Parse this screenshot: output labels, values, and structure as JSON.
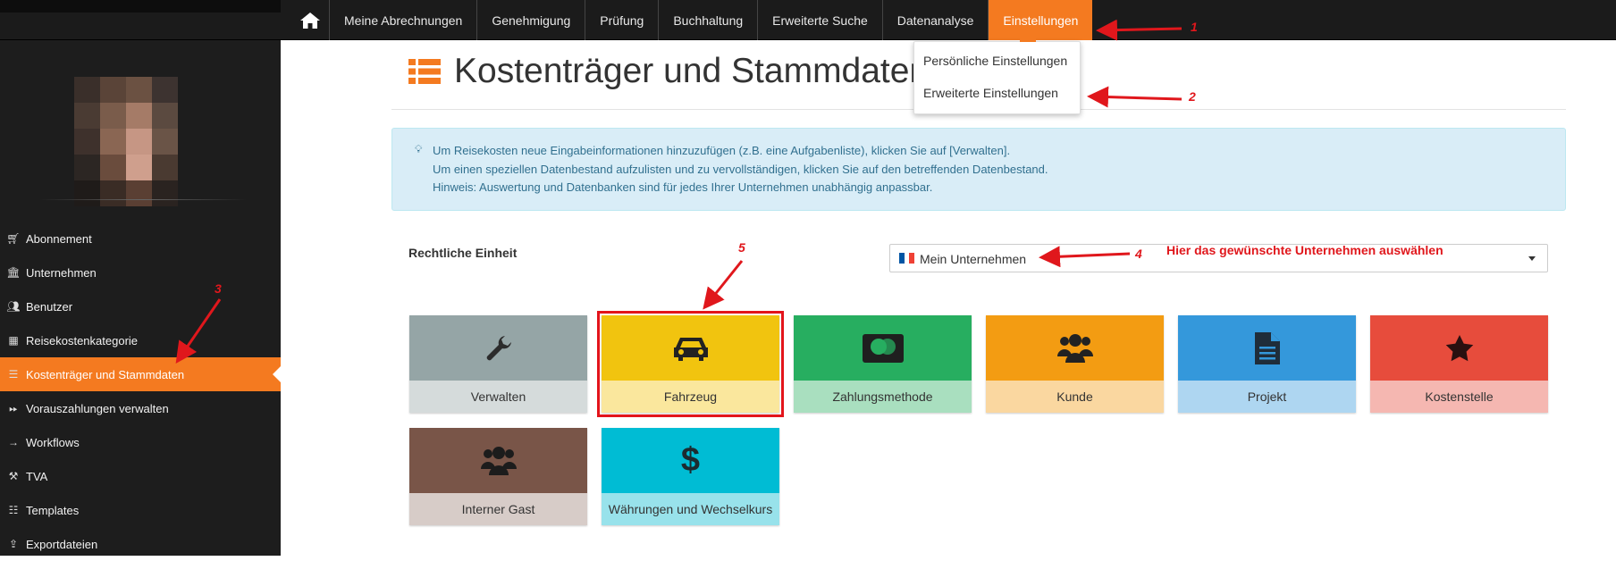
{
  "topnav": {
    "home_icon": "home-icon",
    "items": [
      "Meine Abrechnungen",
      "Genehmigung",
      "Prüfung",
      "Buchhaltung",
      "Erweiterte Suche",
      "Datenanalyse",
      "Einstellungen"
    ],
    "active_index": 6
  },
  "dropdown": {
    "items": [
      "Persönliche Einstellungen",
      "Erweiterte Einstellungen"
    ]
  },
  "sidebar": {
    "items": [
      {
        "label": "Abonnement",
        "icon": "cart-icon"
      },
      {
        "label": "Unternehmen",
        "icon": "bank-icon"
      },
      {
        "label": "Benutzer",
        "icon": "users-icon"
      },
      {
        "label": "Reisekostenkategorie",
        "icon": "grid-icon"
      },
      {
        "label": "Kostenträger und Stammdaten",
        "icon": "list-icon"
      },
      {
        "label": "Vorauszahlungen verwalten",
        "icon": "forward-icon"
      },
      {
        "label": "Workflows",
        "icon": "arrow-right-icon"
      },
      {
        "label": "TVA",
        "icon": "gavel-icon"
      },
      {
        "label": "Templates",
        "icon": "list-alt-icon"
      },
      {
        "label": "Exportdateien",
        "icon": "export-icon"
      }
    ],
    "active_index": 4
  },
  "page": {
    "title": "Kostenträger und Stammdaten",
    "alert_lines": [
      "Um Reisekosten neue Eingabeinformationen hinzuzufügen (z.B. eine Aufgabenliste), klicken Sie auf [Verwalten].",
      "Um einen speziellen Datenbestand aufzulisten und zu vervollständigen, klicken Sie auf den betreffenden Datenbestand.",
      "Hinweis: Auswertung und Datenbanken sind für jedes Ihrer Unternehmen unabhängig anpassbar."
    ],
    "legal_entity_label": "Rechtliche Einheit",
    "legal_entity_value": "Mein Unternehmen"
  },
  "tiles": [
    {
      "label": "Verwalten",
      "icon": "wrench-icon",
      "color": "#95a5a6",
      "light": "#d5dbdb"
    },
    {
      "label": "Fahrzeug",
      "icon": "car-icon",
      "color": "#f1c40f",
      "light": "#fae79d",
      "selected": true
    },
    {
      "label": "Zahlungsmethode",
      "icon": "credit-card-icon",
      "color": "#27ae60",
      "light": "#a9dfbf"
    },
    {
      "label": "Kunde",
      "icon": "users-icon",
      "color": "#f39c12",
      "light": "#fad7a0"
    },
    {
      "label": "Projekt",
      "icon": "file-icon",
      "color": "#3498db",
      "light": "#aed6f1"
    },
    {
      "label": "Kostenstelle",
      "icon": "star-icon",
      "color": "#e74c3c",
      "light": "#f5b7b1"
    },
    {
      "label": "Interner Gast",
      "icon": "users-icon",
      "color": "#795548",
      "light": "#d7ccc8"
    },
    {
      "label": "Währungen und Wechselkurs",
      "icon": "dollar-icon",
      "color": "#00bcd4",
      "light": "#98e2eb"
    }
  ],
  "annotations": {
    "numbers": [
      "1",
      "2",
      "3",
      "4",
      "5"
    ],
    "hint_text": "Hier das gewünschte Unternehmen auswählen",
    "color": "#e0171c"
  }
}
